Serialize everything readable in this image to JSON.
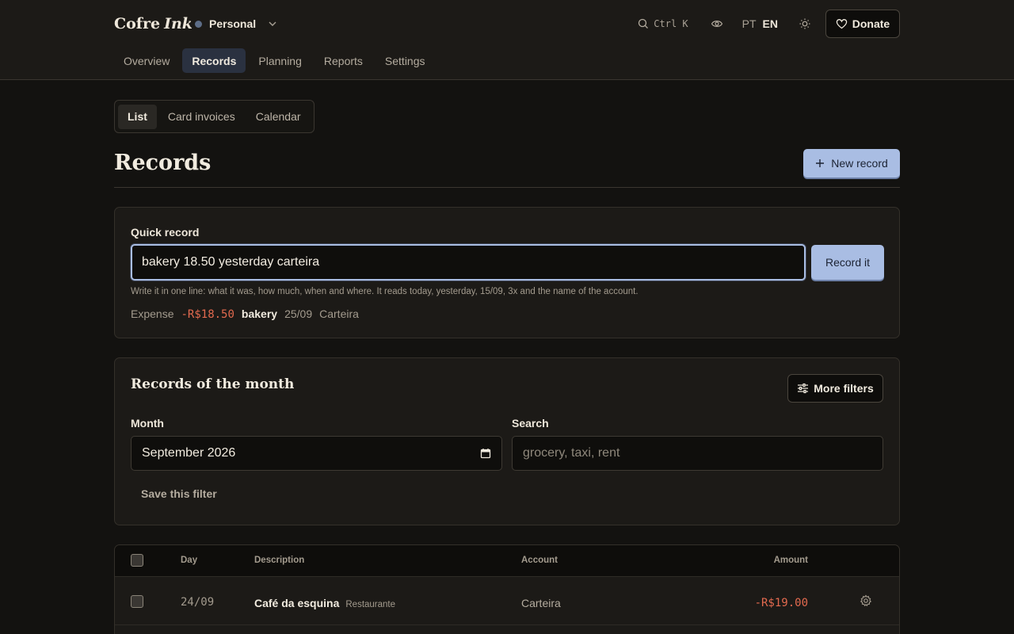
{
  "header": {
    "brand_main": "Cofre",
    "brand_accent": "Ink",
    "profile": {
      "name": "Personal",
      "dot_color": "#5d6d87"
    },
    "search_shortcut": "Ctrl K",
    "languages": {
      "pt": "PT",
      "en": "EN",
      "active": "EN"
    },
    "donate_label": "Donate",
    "nav": [
      {
        "label": "Overview",
        "active": false
      },
      {
        "label": "Records",
        "active": true
      },
      {
        "label": "Planning",
        "active": false
      },
      {
        "label": "Reports",
        "active": false
      },
      {
        "label": "Settings",
        "active": false
      }
    ]
  },
  "subtabs": [
    {
      "label": "List",
      "active": true
    },
    {
      "label": "Card invoices",
      "active": false
    },
    {
      "label": "Calendar",
      "active": false
    }
  ],
  "page": {
    "title": "Records",
    "new_record_label": "New record"
  },
  "quick_record": {
    "label": "Quick record",
    "value": "bakery 18.50 yesterday carteira",
    "button_label": "Record it",
    "help": "Write it in one line: what it was, how much, when and where. It reads today, yesterday, 15/09, 3x and the name of the account.",
    "preview": {
      "kind": "Expense",
      "amount": "-R$18.50",
      "description": "bakery",
      "date": "25/09",
      "account": "Carteira"
    }
  },
  "records_month": {
    "title": "Records of the month",
    "more_filters_label": "More filters",
    "month_label": "Month",
    "month_value": "September 2026",
    "search_label": "Search",
    "search_placeholder": "grocery, taxi, rent",
    "save_filter_label": "Save this filter"
  },
  "table": {
    "columns": {
      "day": "Day",
      "description": "Description",
      "account": "Account",
      "amount": "Amount"
    },
    "rows": [
      {
        "day": "24/09",
        "description": "Café da esquina",
        "category": "Restaurante",
        "account": "Carteira",
        "amount": "-R$19.00"
      }
    ]
  },
  "colors": {
    "accent": "#a9bde3",
    "expense": "#e36a4f",
    "background": "#131210",
    "surface": "#1c1a17"
  }
}
